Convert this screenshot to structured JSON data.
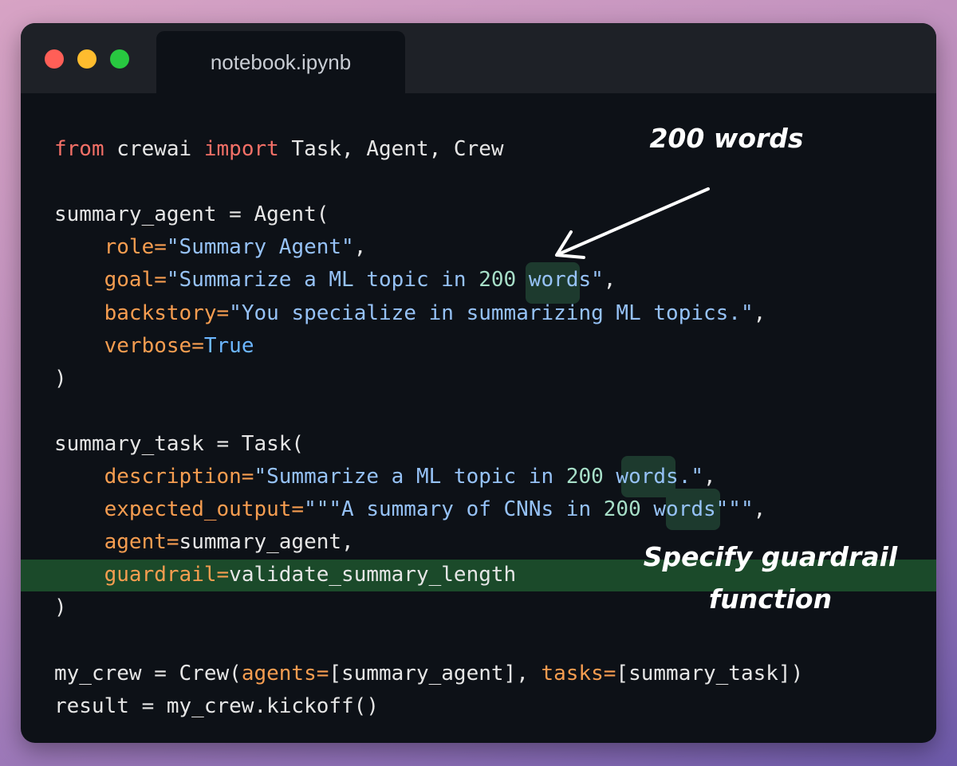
{
  "window": {
    "tab_title": "notebook.ipynb"
  },
  "code_lines": [
    [
      [
        "kw",
        "from"
      ],
      [
        "p",
        " crewai "
      ],
      [
        "kw",
        "import"
      ],
      [
        "p",
        " Task, Agent, Crew"
      ]
    ],
    [],
    [
      [
        "p",
        "summary_agent = Agent("
      ]
    ],
    [
      [
        "p",
        "    "
      ],
      [
        "attr",
        "role="
      ],
      [
        "str",
        "\"Summary Agent\""
      ],
      [
        "p",
        ","
      ]
    ],
    [
      [
        "p",
        "    "
      ],
      [
        "attr",
        "goal="
      ],
      [
        "str",
        "\"Summarize a ML topic in "
      ],
      [
        "num",
        "200"
      ],
      [
        "str",
        " words\""
      ],
      [
        "p",
        ","
      ]
    ],
    [
      [
        "p",
        "    "
      ],
      [
        "attr",
        "backstory="
      ],
      [
        "str",
        "\"You specialize in summarizing ML topics.\""
      ],
      [
        "p",
        ","
      ]
    ],
    [
      [
        "p",
        "    "
      ],
      [
        "attr",
        "verbose="
      ],
      [
        "bool",
        "True"
      ]
    ],
    [
      [
        "p",
        ")"
      ]
    ],
    [],
    [
      [
        "p",
        "summary_task = Task("
      ]
    ],
    [
      [
        "p",
        "    "
      ],
      [
        "attr",
        "description="
      ],
      [
        "str",
        "\"Summarize a ML topic in "
      ],
      [
        "num",
        "200"
      ],
      [
        "str",
        " words.\""
      ],
      [
        "p",
        ","
      ]
    ],
    [
      [
        "p",
        "    "
      ],
      [
        "attr",
        "expected_output="
      ],
      [
        "str",
        "\"\"\"A summary of CNNs in "
      ],
      [
        "num",
        "200"
      ],
      [
        "str",
        " words\"\"\""
      ],
      [
        "p",
        ","
      ]
    ],
    [
      [
        "p",
        "    "
      ],
      [
        "attr",
        "agent="
      ],
      [
        "p",
        "summary_agent,"
      ]
    ],
    [
      [
        "p",
        "    "
      ],
      [
        "attr",
        "guardrail="
      ],
      [
        "p",
        "validate_summary_length"
      ]
    ],
    [
      [
        "p",
        ")"
      ]
    ],
    [],
    [
      [
        "p",
        "my_crew = Crew("
      ],
      [
        "attr",
        "agents="
      ],
      [
        "p",
        "[summary_agent], "
      ],
      [
        "attr",
        "tasks="
      ],
      [
        "p",
        "[summary_task])"
      ]
    ],
    [
      [
        "p",
        "result = my_crew.kickoff()"
      ]
    ]
  ],
  "annotations": {
    "words_note": "200 words",
    "guardrail_note_line1": "Specify guardrail",
    "guardrail_note_line2": "function"
  },
  "colors": {
    "keyword": "#f47067",
    "attribute": "#f69d50",
    "string": "#96c2f7",
    "boolean": "#6cb6ff",
    "number": "#a7dfc8",
    "highlight_line": "#1b4a2a"
  }
}
